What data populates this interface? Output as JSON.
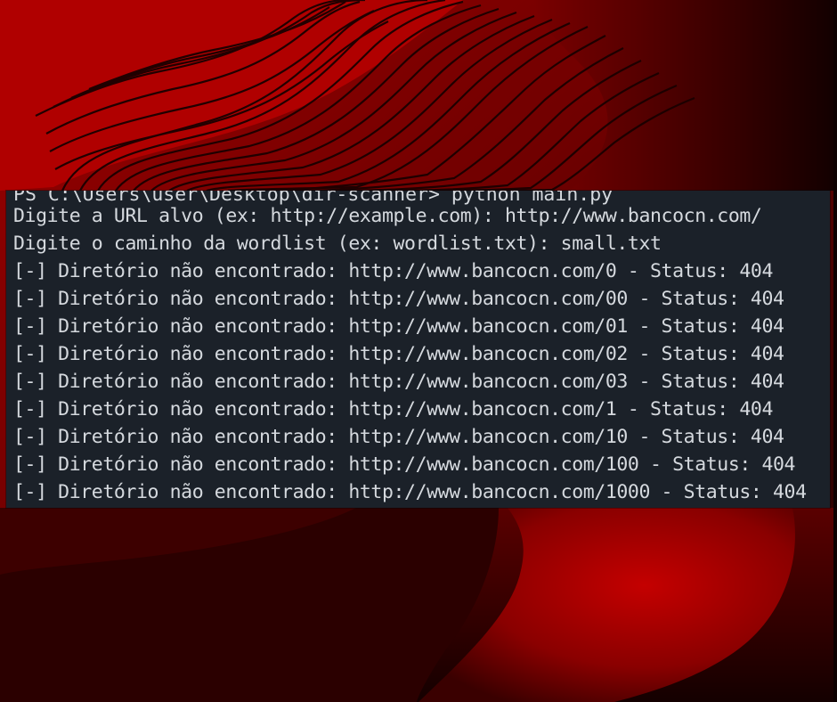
{
  "terminal": {
    "partial_top_line": "PS C:\\Users\\user\\Desktop\\dir-scanner> python main.py",
    "lines": [
      "Digite a URL alvo (ex: http://example.com): http://www.bancocn.com/",
      "Digite o caminho da wordlist (ex: wordlist.txt): small.txt",
      "[-] Diretório não encontrado: http://www.bancocn.com/0 - Status: 404",
      "[-] Diretório não encontrado: http://www.bancocn.com/00 - Status: 404",
      "[-] Diretório não encontrado: http://www.bancocn.com/01 - Status: 404",
      "[-] Diretório não encontrado: http://www.bancocn.com/02 - Status: 404",
      "[-] Diretório não encontrado: http://www.bancocn.com/03 - Status: 404",
      "[-] Diretório não encontrado: http://www.bancocn.com/1 - Status: 404",
      "[-] Diretório não encontrado: http://www.bancocn.com/10 - Status: 404",
      "[-] Diretório não encontrado: http://www.bancocn.com/100 - Status: 404",
      "[-] Diretório não encontrado: http://www.bancocn.com/1000 - Status: 404"
    ]
  },
  "colors": {
    "terminal_bg": "#1b2129",
    "terminal_text": "#d5d9de",
    "accent_red": "#c00000",
    "dark_red": "#3a0000"
  }
}
